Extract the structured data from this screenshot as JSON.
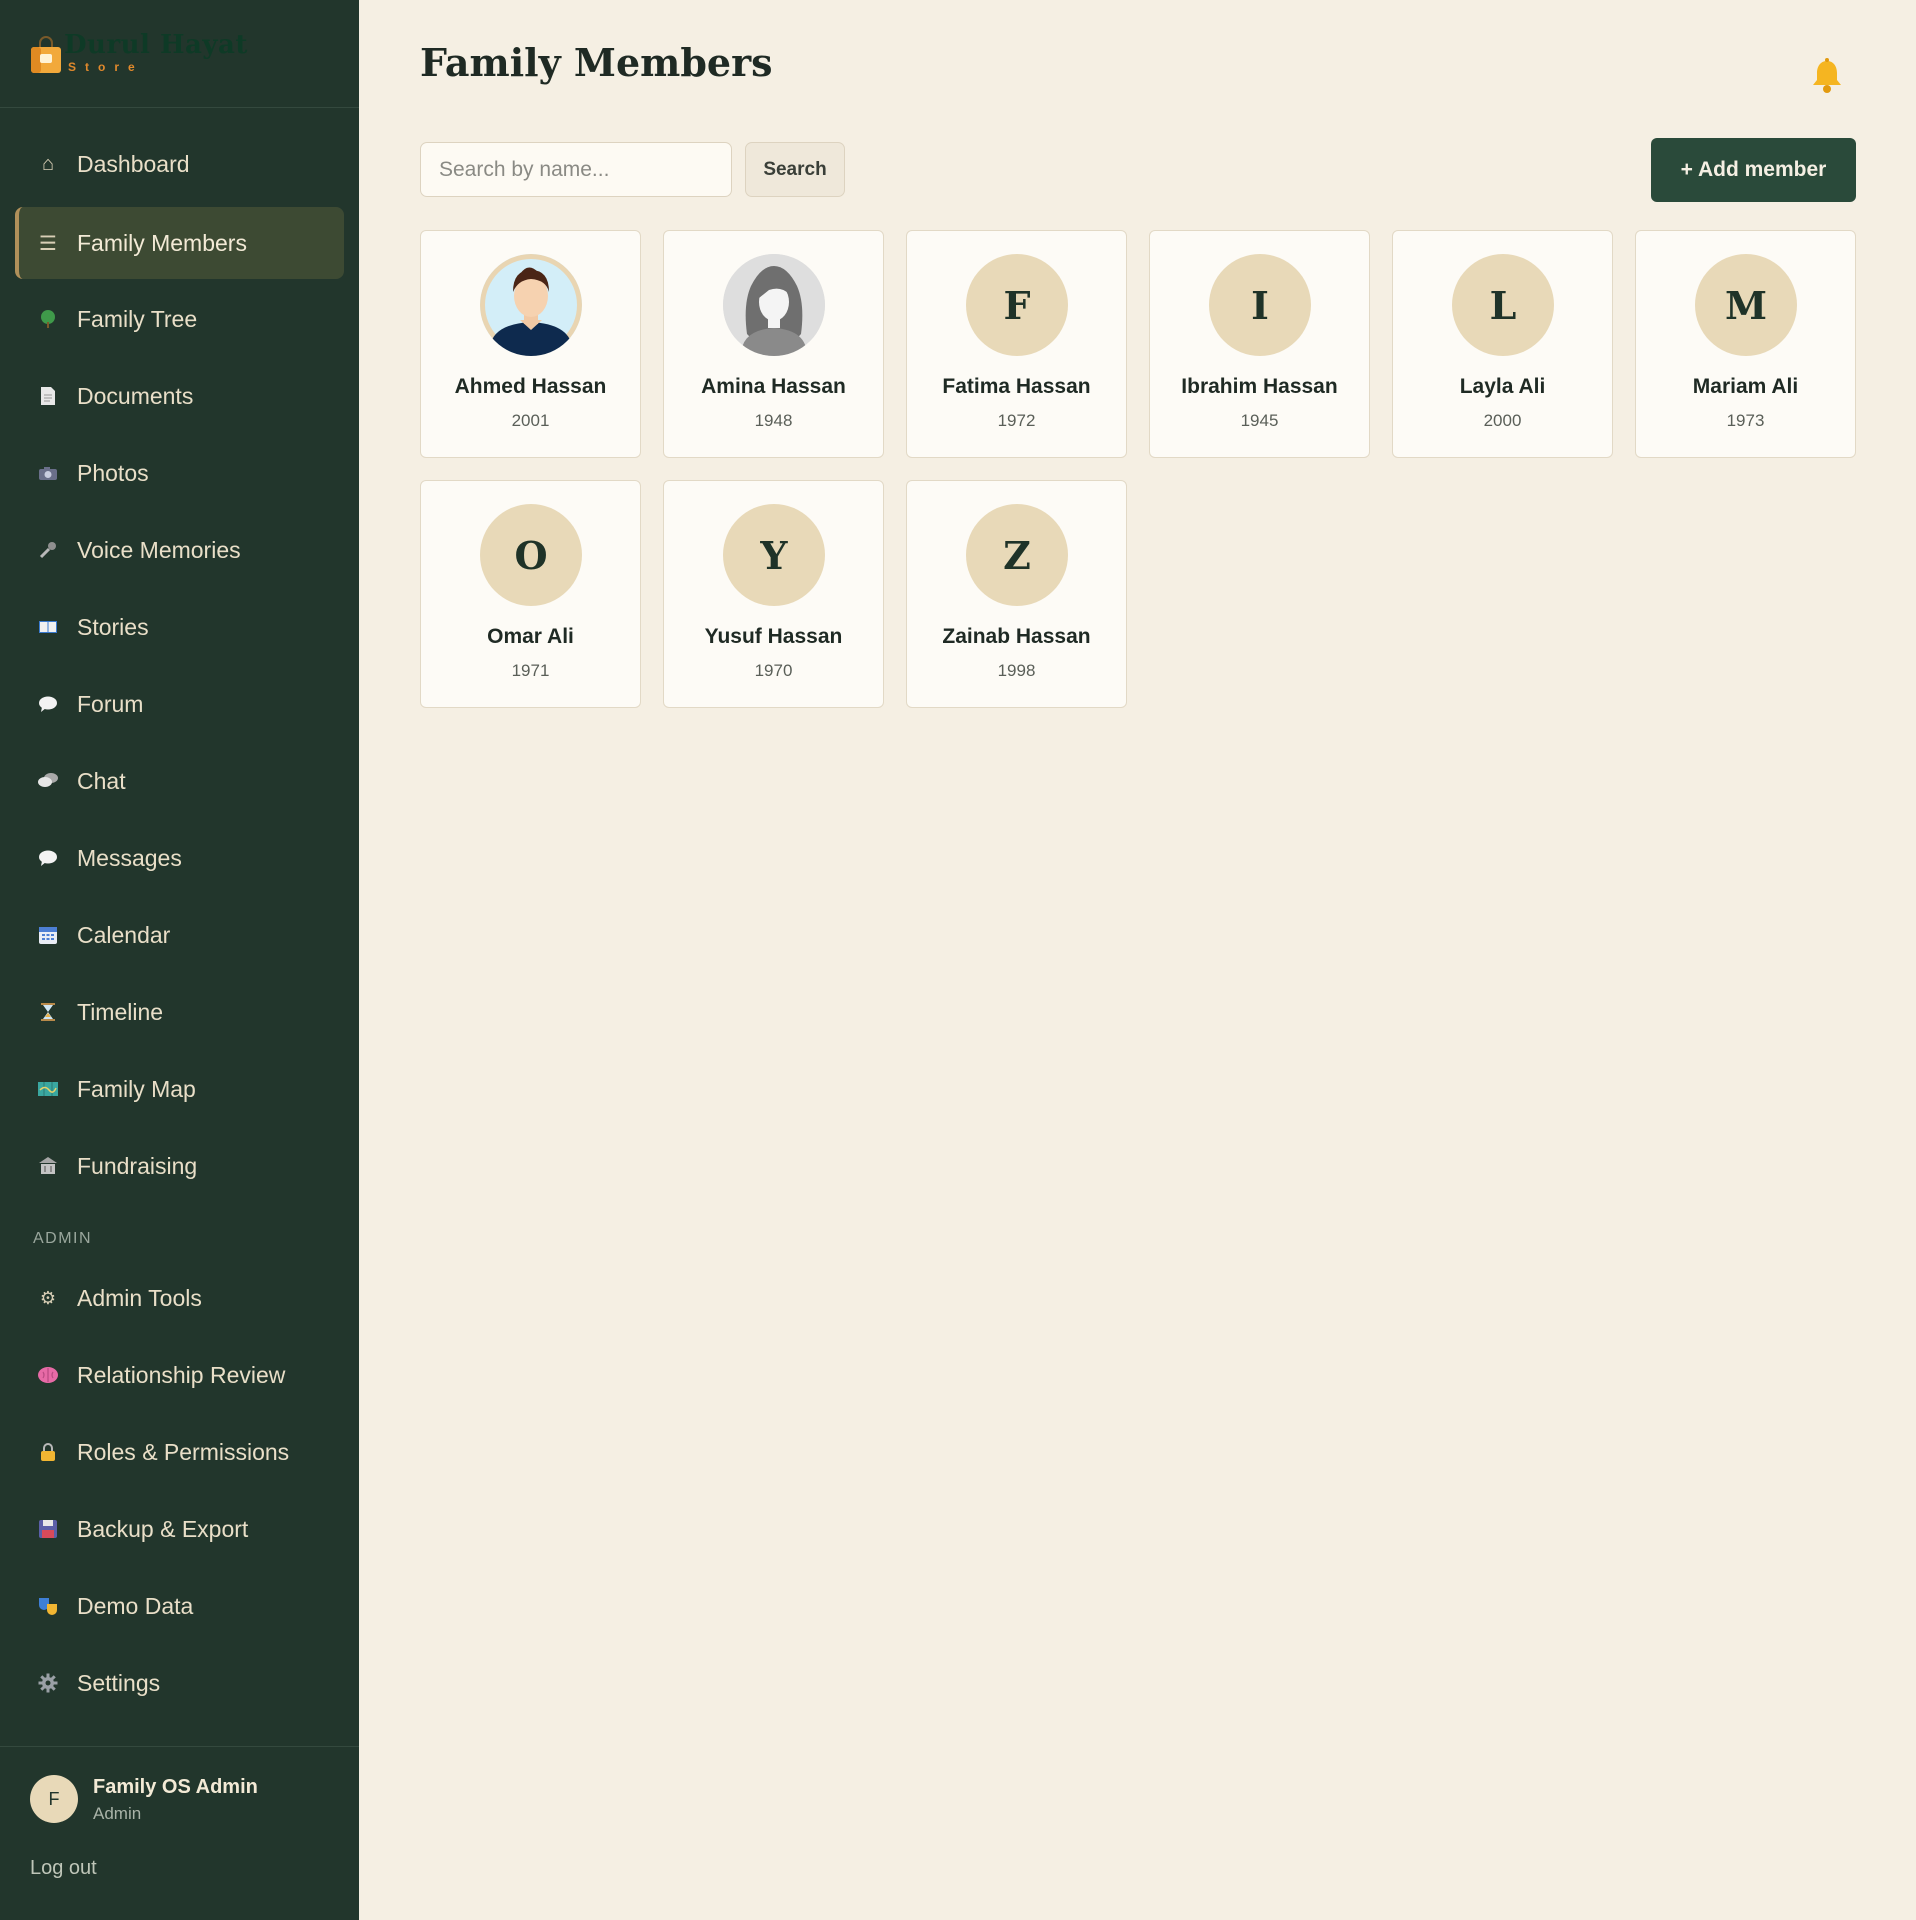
{
  "brand": {
    "name": "Durul Hayat",
    "sub": "Store",
    "colors": {
      "sidebar": "#22362c",
      "accent": "#2a4a3a",
      "background": "#f5efe3",
      "avatar": "#e8d9b8"
    }
  },
  "sidebar": {
    "items": [
      {
        "label": "Dashboard",
        "icon": "home-icon"
      },
      {
        "label": "Family Members",
        "icon": "list-icon",
        "active": true
      },
      {
        "label": "Family Tree",
        "icon": "tree-icon"
      },
      {
        "label": "Documents",
        "icon": "document-icon"
      },
      {
        "label": "Photos",
        "icon": "camera-icon"
      },
      {
        "label": "Voice Memories",
        "icon": "microphone-icon"
      },
      {
        "label": "Stories",
        "icon": "book-icon"
      },
      {
        "label": "Forum",
        "icon": "speech-bubble-icon"
      },
      {
        "label": "Chat",
        "icon": "chat-bubbles-icon"
      },
      {
        "label": "Messages",
        "icon": "message-icon"
      },
      {
        "label": "Calendar",
        "icon": "calendar-icon"
      },
      {
        "label": "Timeline",
        "icon": "hourglass-icon"
      },
      {
        "label": "Family Map",
        "icon": "map-icon"
      },
      {
        "label": "Fundraising",
        "icon": "bank-icon"
      }
    ],
    "admin_label": "ADMIN",
    "admin_items": [
      {
        "label": "Admin Tools",
        "icon": "gear-small-icon"
      },
      {
        "label": "Relationship Review",
        "icon": "brain-icon"
      },
      {
        "label": "Roles & Permissions",
        "icon": "lock-icon"
      },
      {
        "label": "Backup & Export",
        "icon": "floppy-disk-icon"
      },
      {
        "label": "Demo Data",
        "icon": "theater-masks-icon"
      },
      {
        "label": "Settings",
        "icon": "gear-icon"
      }
    ],
    "user": {
      "initial": "F",
      "name": "Family OS Admin",
      "role": "Admin",
      "logout": "Log out"
    }
  },
  "main": {
    "title": "Family Members",
    "search_placeholder": "Search by name...",
    "search_button": "Search",
    "add_button": "+ Add member",
    "members": [
      {
        "name": "Ahmed Hassan",
        "year": "2001",
        "avatar": "male-photo"
      },
      {
        "name": "Amina Hassan",
        "year": "1948",
        "avatar": "female-silhouette"
      },
      {
        "name": "Fatima Hassan",
        "year": "1972",
        "initial": "F"
      },
      {
        "name": "Ibrahim Hassan",
        "year": "1945",
        "initial": "I"
      },
      {
        "name": "Layla Ali",
        "year": "2000",
        "initial": "L"
      },
      {
        "name": "Mariam Ali",
        "year": "1973",
        "initial": "M"
      },
      {
        "name": "Omar Ali",
        "year": "1971",
        "initial": "O"
      },
      {
        "name": "Yusuf Hassan",
        "year": "1970",
        "initial": "Y"
      },
      {
        "name": "Zainab Hassan",
        "year": "1998",
        "initial": "Z"
      }
    ]
  }
}
